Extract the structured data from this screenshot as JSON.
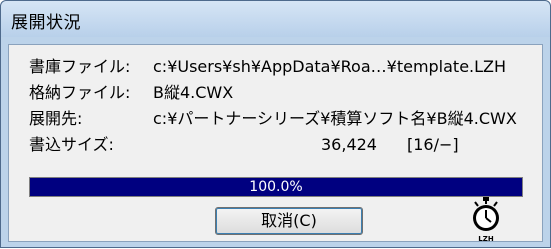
{
  "window": {
    "title": "展開状況"
  },
  "info": {
    "archive_label": "書庫ファイル:",
    "archive_value": "c:¥Users¥sh¥AppData¥Roa…¥template.LZH",
    "stored_label": "格納ファイル:",
    "stored_value": "B縦4.CWX",
    "dest_label": "展開先:",
    "dest_value": "c:¥パートナーシリーズ¥積算ソフト名¥B縦4.CWX",
    "size_label": "書込サイズ:",
    "size_value": "36,424",
    "size_ratio": "[16/−]"
  },
  "progress": {
    "percent": 100,
    "label": "100.0%"
  },
  "buttons": {
    "cancel_label": "取消(C)"
  },
  "icons": {
    "timer_icon": "stopwatch-icon",
    "timer_caption": "LZH"
  },
  "colors": {
    "progress_fill": "#000080",
    "titlebar": "#bcd3ea"
  }
}
